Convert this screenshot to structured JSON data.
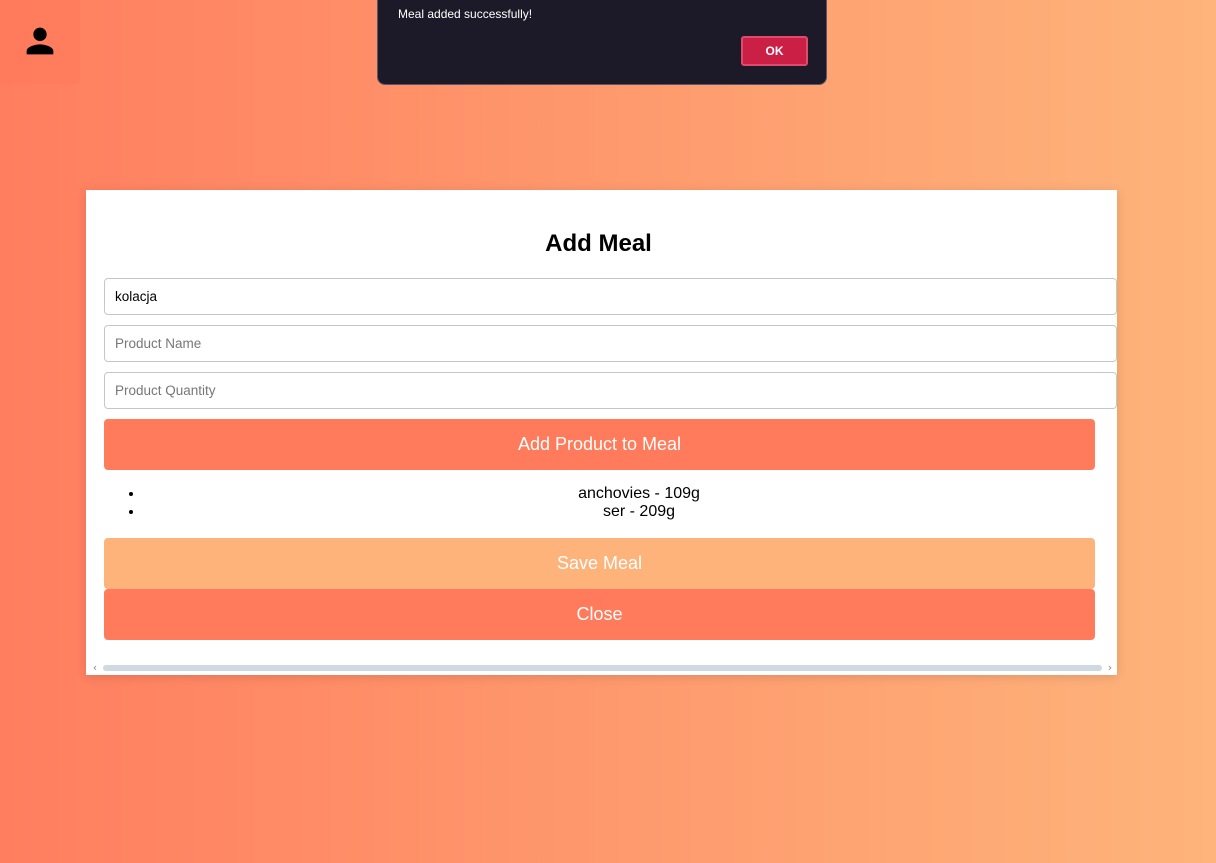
{
  "alert": {
    "message": "Meal added successfully!",
    "ok_label": "OK"
  },
  "header": {
    "avatar_icon": "user-icon"
  },
  "modal": {
    "title": "Add Meal",
    "meal_name_value": "kolacja",
    "product_name_placeholder": "Product Name",
    "product_quantity_placeholder": "Product Quantity",
    "add_product_label": "Add Product to Meal",
    "products": [
      "anchovies - 109g",
      "ser - 209g"
    ],
    "save_label": "Save Meal",
    "close_label": "Close"
  },
  "colors": {
    "gradient_start": "#ff7e5f",
    "gradient_end": "#feb47b",
    "primary_button": "#ff7b5c",
    "save_button": "#feb37b",
    "alert_background": "#1c1a28",
    "alert_ok": "#cc1f45"
  }
}
